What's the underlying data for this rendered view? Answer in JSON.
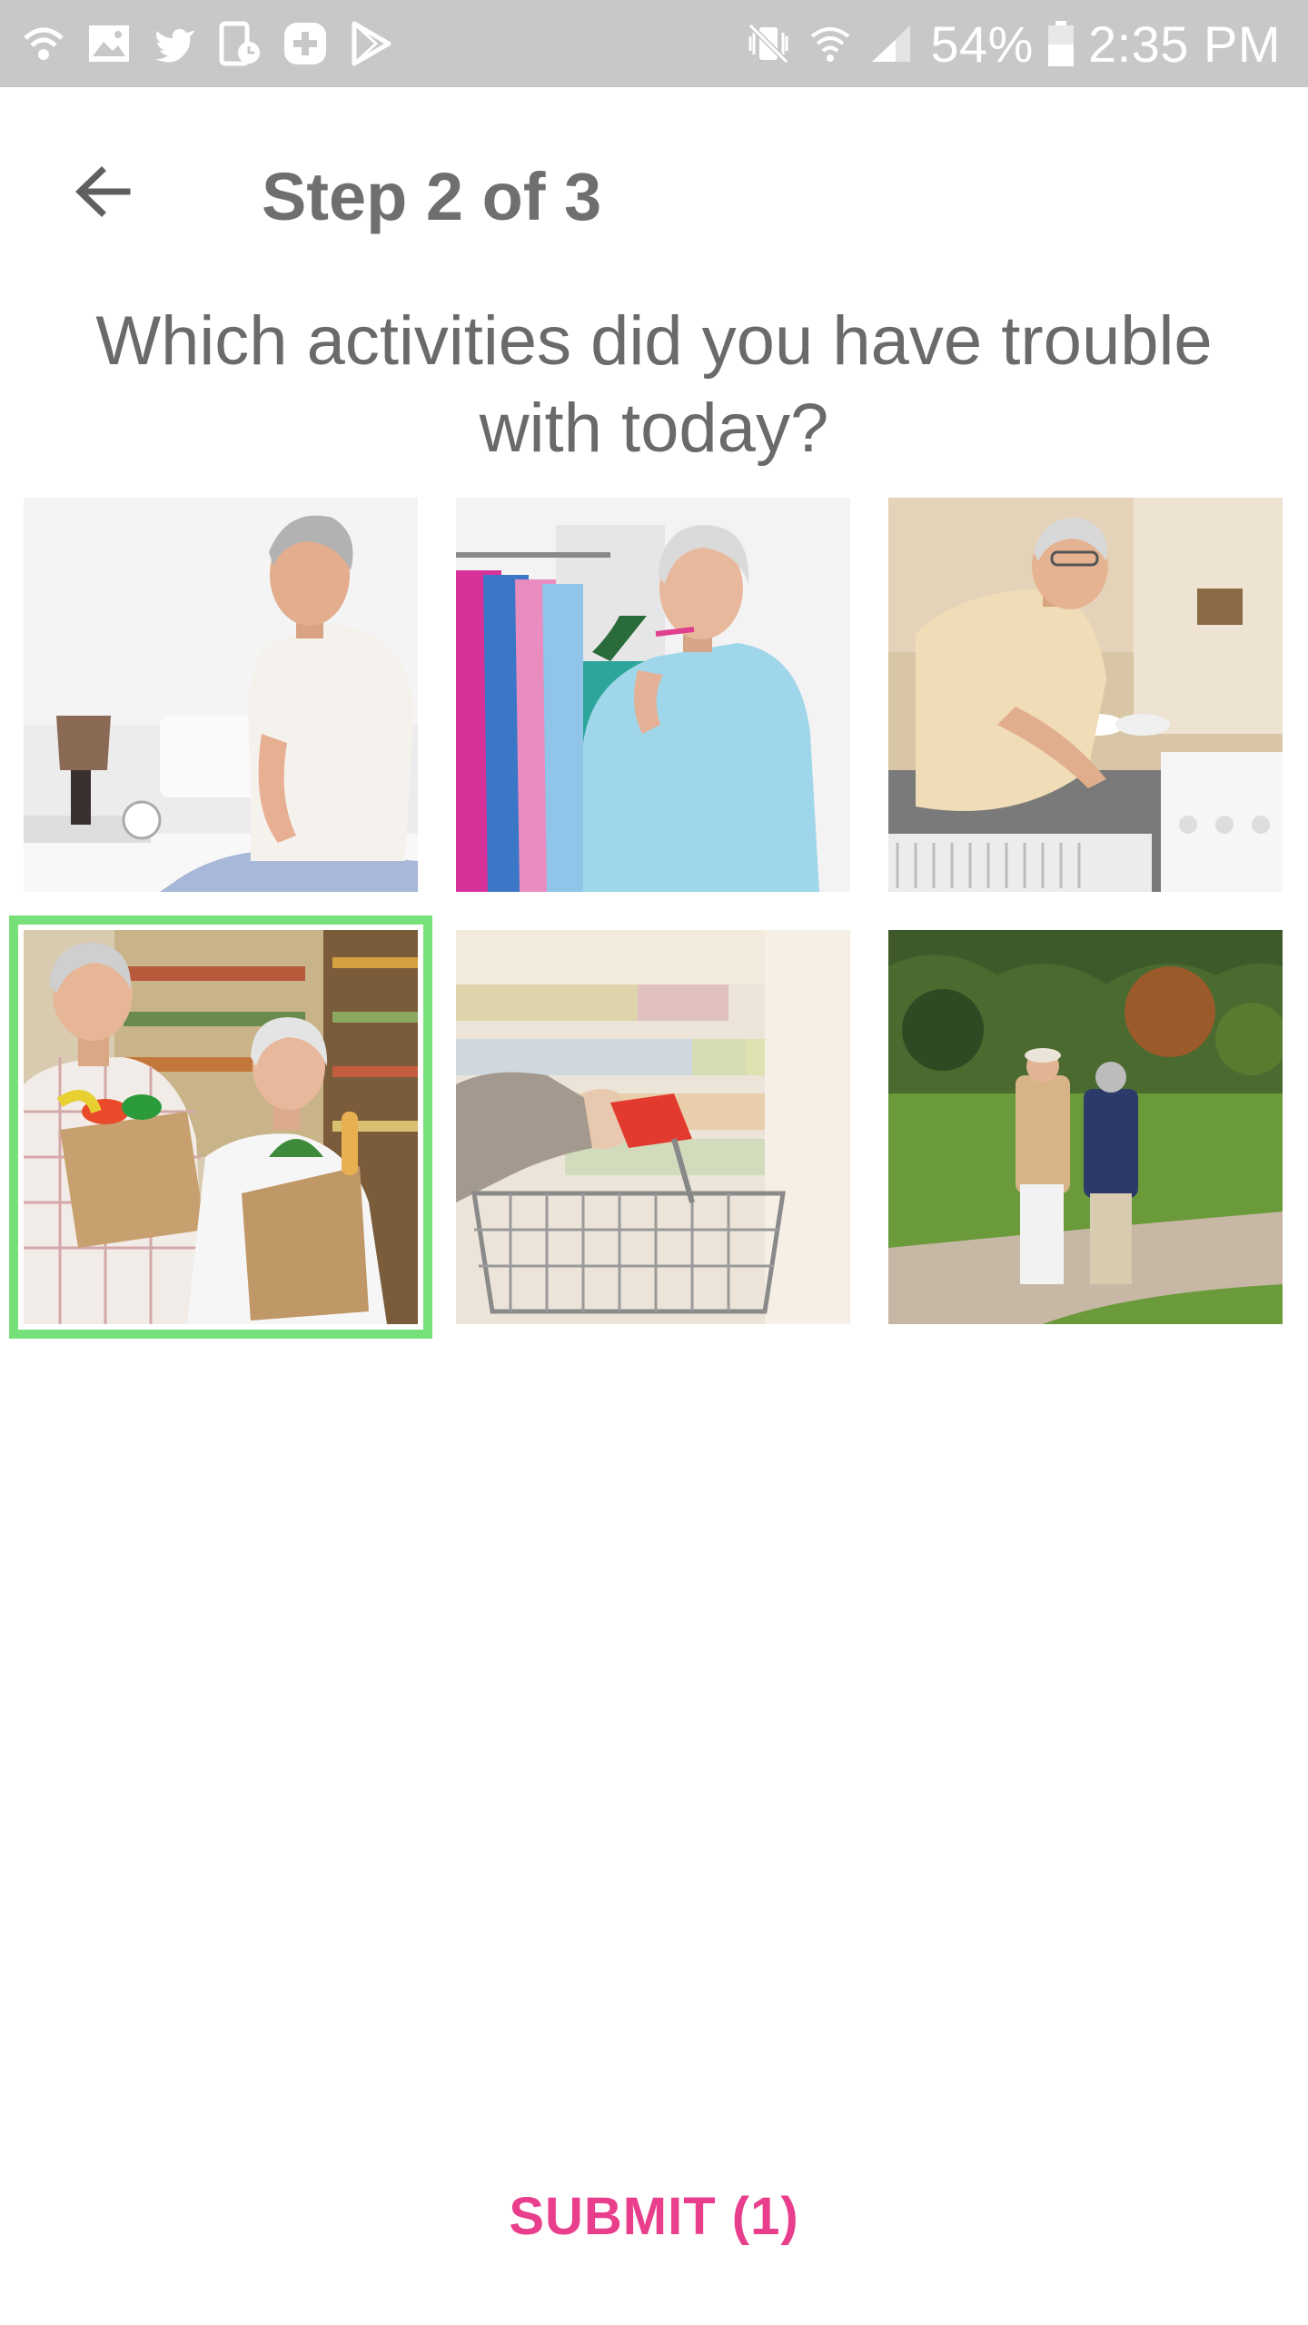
{
  "status_bar": {
    "battery": "54%",
    "time": "2:35 PM",
    "left_icons": [
      "wifi-calling-icon",
      "image-icon",
      "twitter-icon",
      "device-clock-icon",
      "plus-circle-icon",
      "play-store-icon"
    ],
    "right_icons": [
      "vibrate-mute-icon",
      "wifi-icon",
      "signal-icon",
      "battery-icon"
    ]
  },
  "header": {
    "title": "Step 2 of 3",
    "back_icon": "arrow-left-icon"
  },
  "question": "Which activities did you have trouble with today?",
  "activities": [
    {
      "subject": "getting-out-of-bed",
      "selected": false
    },
    {
      "subject": "getting-dressed",
      "selected": false
    },
    {
      "subject": "washing-dishes",
      "selected": false
    },
    {
      "subject": "carrying-groceries",
      "selected": true
    },
    {
      "subject": "pushing-shopping-cart",
      "selected": false
    },
    {
      "subject": "walking-outdoors",
      "selected": false
    }
  ],
  "selection_color": "#77e07a",
  "submit": {
    "label": "SUBMIT (1)",
    "color": "#e83e8c"
  }
}
